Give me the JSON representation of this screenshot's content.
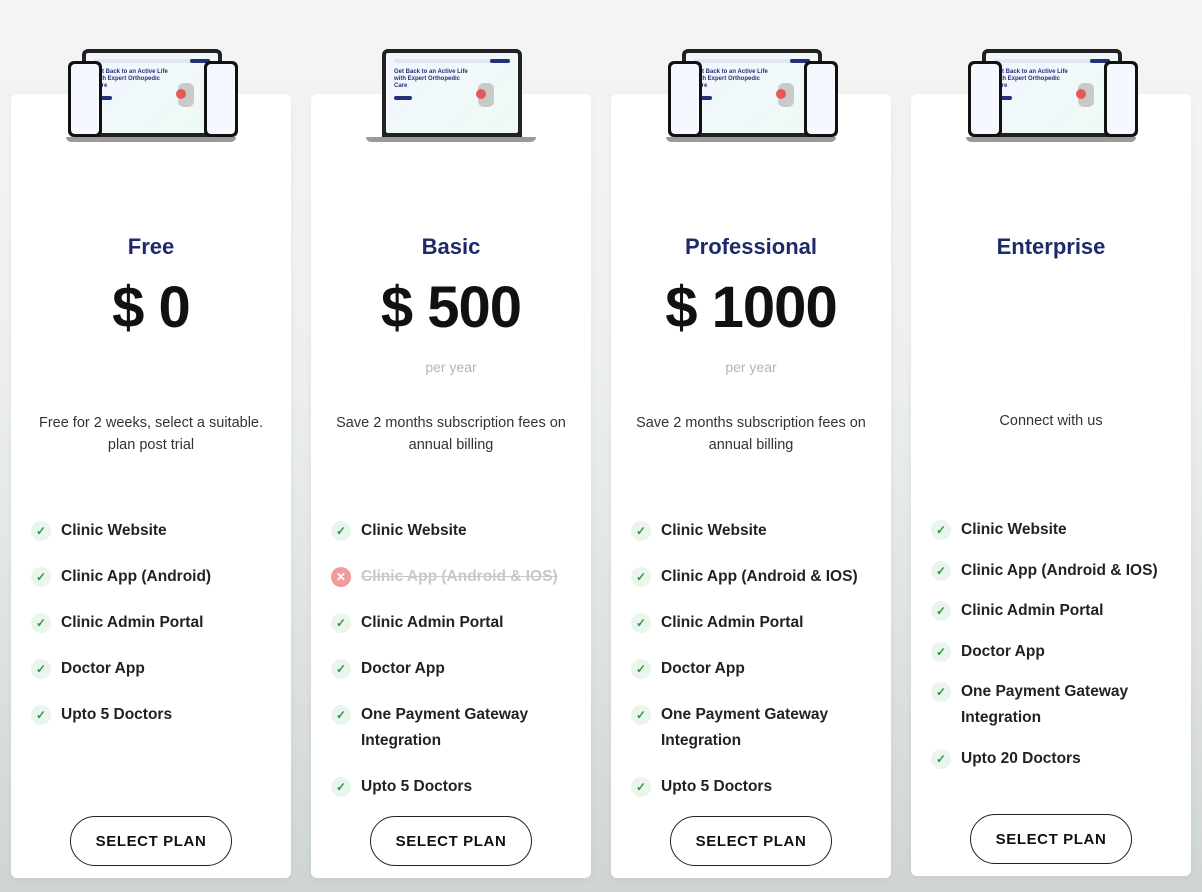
{
  "mockup_text": "Get Back to an Active Life with Expert Orthopedic Care",
  "plans": [
    {
      "title": "Free",
      "price": "$ 0",
      "period": "",
      "description": "Free for 2 weeks, select a suitable. plan post trial",
      "features": [
        {
          "label": "Clinic Website",
          "included": true
        },
        {
          "label": "Clinic App (Android)",
          "included": true
        },
        {
          "label": "Clinic Admin Portal",
          "included": true
        },
        {
          "label": "Doctor App",
          "included": true
        },
        {
          "label": "Upto 5 Doctors",
          "included": true
        }
      ],
      "button": "SELECT PLAN"
    },
    {
      "title": "Basic",
      "price": "$ 500",
      "period": "per year",
      "description": "Save 2 months subscription fees on annual billing",
      "features": [
        {
          "label": "Clinic Website",
          "included": true
        },
        {
          "label": "Clinic App (Android & IOS)",
          "included": false
        },
        {
          "label": "Clinic Admin Portal",
          "included": true
        },
        {
          "label": "Doctor App",
          "included": true
        },
        {
          "label": "One Payment Gateway Integration",
          "included": true
        },
        {
          "label": "Upto 5 Doctors",
          "included": true
        }
      ],
      "button": "SELECT PLAN"
    },
    {
      "title": "Professional",
      "price": "$ 1000",
      "period": "per year",
      "description": "Save 2 months subscription fees on annual billing",
      "features": [
        {
          "label": "Clinic Website",
          "included": true
        },
        {
          "label": "Clinic App (Android & IOS)",
          "included": true
        },
        {
          "label": "Clinic Admin Portal",
          "included": true
        },
        {
          "label": "Doctor App",
          "included": true
        },
        {
          "label": "One Payment Gateway Integration",
          "included": true
        },
        {
          "label": "Upto 5 Doctors",
          "included": true
        }
      ],
      "button": "SELECT PLAN"
    },
    {
      "title": "Enterprise",
      "price": "",
      "period": "",
      "description": "Connect with us",
      "features": [
        {
          "label": "Clinic Website",
          "included": true
        },
        {
          "label": "Clinic App (Android & IOS)",
          "included": true
        },
        {
          "label": "Clinic Admin Portal",
          "included": true
        },
        {
          "label": "Doctor App",
          "included": true
        },
        {
          "label": "One Payment Gateway Integration",
          "included": true
        },
        {
          "label": "Upto 20 Doctors",
          "included": true
        }
      ],
      "button": "SELECT PLAN"
    }
  ],
  "colors": {
    "title": "#1f2a6b",
    "check": "#2e9a47",
    "cross": "#f19b9b"
  },
  "icons": {
    "included": "check-icon",
    "excluded": "x-circle-icon"
  }
}
